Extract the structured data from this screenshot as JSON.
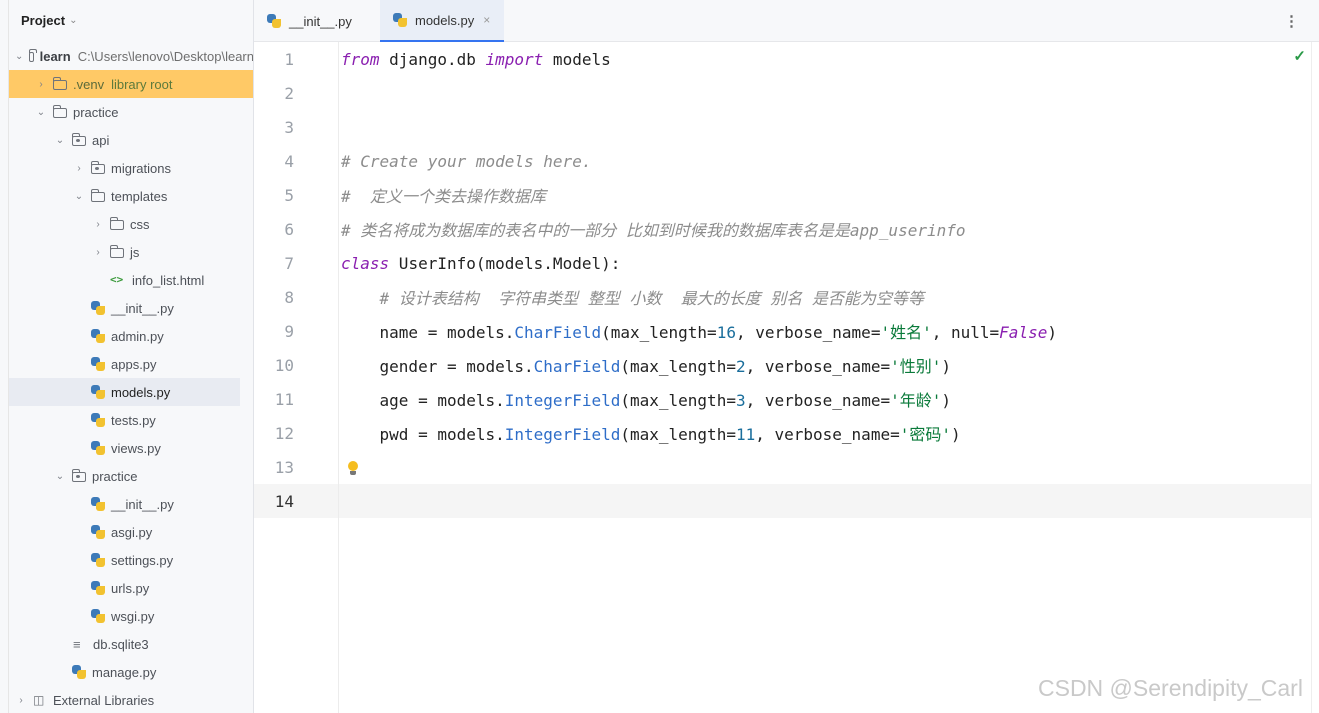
{
  "project_panel": {
    "title": "Project",
    "tree": [
      {
        "label": "learn",
        "hint": "C:\\Users\\lenovo\\Desktop\\learn"
      },
      {
        "label": ".venv",
        "hint": "library root"
      },
      {
        "label": "practice"
      },
      {
        "label": "api"
      },
      {
        "label": "migrations"
      },
      {
        "label": "templates"
      },
      {
        "label": "css"
      },
      {
        "label": "js"
      },
      {
        "label": "info_list.html"
      },
      {
        "label": "__init__.py"
      },
      {
        "label": "admin.py"
      },
      {
        "label": "apps.py"
      },
      {
        "label": "models.py"
      },
      {
        "label": "tests.py"
      },
      {
        "label": "views.py"
      },
      {
        "label": "practice"
      },
      {
        "label": "__init__.py"
      },
      {
        "label": "asgi.py"
      },
      {
        "label": "settings.py"
      },
      {
        "label": "urls.py"
      },
      {
        "label": "wsgi.py"
      },
      {
        "label": "db.sqlite3"
      },
      {
        "label": "manage.py"
      },
      {
        "label": "External Libraries"
      }
    ]
  },
  "tabs": [
    {
      "label": "__init__.py"
    },
    {
      "label": "models.py",
      "close": "×"
    }
  ],
  "editor": {
    "line_numbers": [
      "1",
      "2",
      "3",
      "4",
      "5",
      "6",
      "7",
      "8",
      "9",
      "10",
      "11",
      "12",
      "13",
      "14"
    ],
    "lines": {
      "l1": {
        "a": "from",
        "b": " django.db ",
        "c": "import",
        "d": " models"
      },
      "l4": "# Create your models here.",
      "l5": "#  定义一个类去操作数据库",
      "l6": "# 类名将成为数据库的表名中的一部分 比如到时候我的数据库表名是是app_userinfo",
      "l7": {
        "kw": "class",
        "name": " UserInfo(models.Model):"
      },
      "l8": "    # 设计表结构  字符串类型 整型 小数  最大的长度 别名 是否能为空等等",
      "l9": {
        "pre": "    name = models.",
        "fn": "CharField",
        "a": "(max_length=",
        "n": "16",
        "b": ", verbose_name=",
        "s": "'姓名'",
        "c": ", null=",
        "bool": "False",
        "d": ")"
      },
      "l10": {
        "pre": "    gender = models.",
        "fn": "CharField",
        "a": "(max_length=",
        "n": "2",
        "b": ", verbose_name=",
        "s": "'性别'",
        "d": ")"
      },
      "l11": {
        "pre": "    age = models.",
        "fn": "IntegerField",
        "a": "(max_length=",
        "n": "3",
        "b": ", verbose_name=",
        "s": "'年龄'",
        "d": ")"
      },
      "l12": {
        "pre": "    pwd = models.",
        "fn": "IntegerField",
        "a": "(max_length=",
        "n": "11",
        "b": ", verbose_name=",
        "s": "'密码'",
        "d": ")"
      }
    },
    "inspection_icon": "check-icon",
    "inspection_glyph": "✓"
  },
  "icons": {
    "more": "⋮",
    "collapsed": "›",
    "expanded": "⌄"
  },
  "watermark": "CSDN @Serendipity_Carl"
}
